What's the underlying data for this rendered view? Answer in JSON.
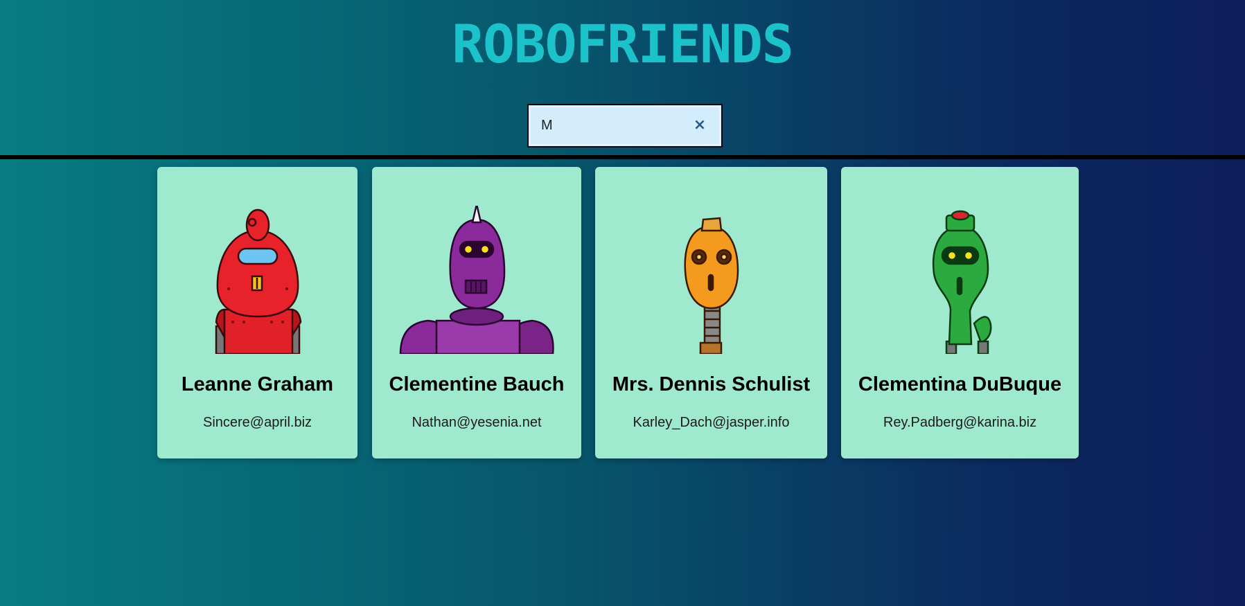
{
  "app": {
    "title": "ROBOFRIENDS"
  },
  "search": {
    "value": "M",
    "placeholder": "",
    "clear_label": "×"
  },
  "robots": [
    {
      "name": "Leanne Graham",
      "email": "Sincere@april.biz",
      "color": "#e8222b"
    },
    {
      "name": "Clementine Bauch",
      "email": "Nathan@yesenia.net",
      "color": "#8b2a9a"
    },
    {
      "name": "Mrs. Dennis Schulist",
      "email": "Karley_Dach@jasper.info",
      "color": "#f49a1e"
    },
    {
      "name": "Clementina DuBuque",
      "email": "Rey.Padberg@karina.biz",
      "color": "#2bab3f"
    }
  ]
}
